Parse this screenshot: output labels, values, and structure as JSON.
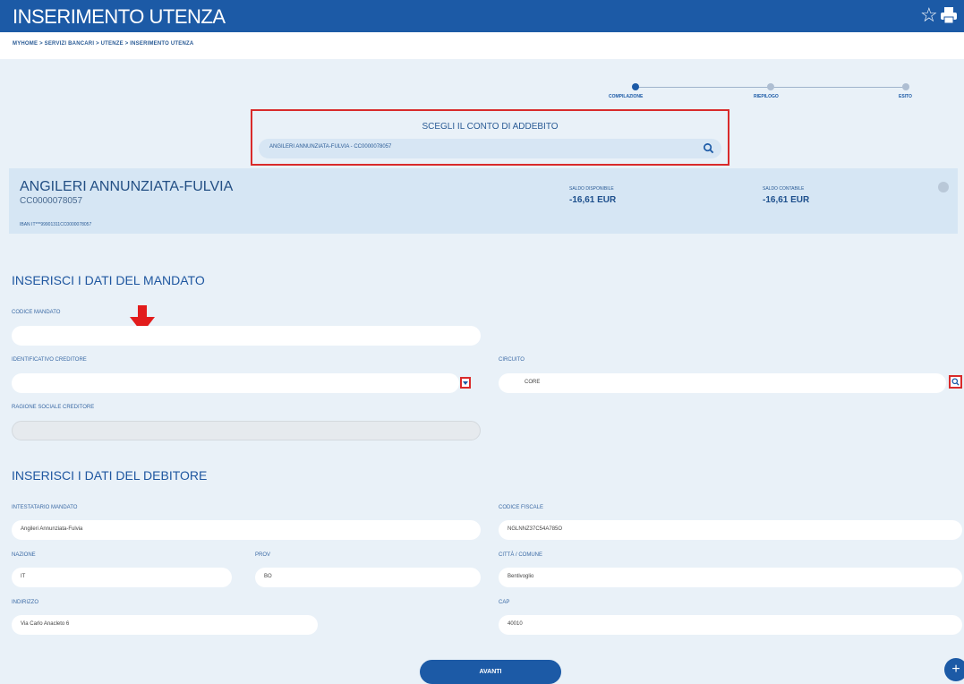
{
  "header": {
    "title": "INSERIMENTO UTENZA",
    "star_icon": "star-icon",
    "print_icon": "printer-icon",
    "breadcrumb": "MYHOME > SERVIZI BANCARI > UTENZE > INSERIMENTO UTENZA"
  },
  "stepper": {
    "steps": [
      {
        "label": "COMPILAZIONE",
        "active": true
      },
      {
        "label": "RIEPILOGO",
        "active": false
      },
      {
        "label": "ESITO",
        "active": false
      }
    ]
  },
  "conto": {
    "heading": "SCEGLI IL CONTO DI ADDEBITO",
    "selected": "ANGILERI ANNUNZIATA-FULVIA - CC0000078057"
  },
  "account": {
    "name": "ANGILERI ANNUNZIATA-FULVIA",
    "code": "CC0000078057",
    "iban": "IBAN IT***99901311CC0000078057",
    "saldo_disponibile_label": "SALDO DISPONIBILE",
    "saldo_disponibile": "-16,61 EUR",
    "saldo_contabile_label": "SALDO CONTABILE",
    "saldo_contabile": "-16,61 EUR"
  },
  "mandato": {
    "title": "INSERISCI I DATI DEL MANDATO",
    "codice_label": "CODICE MANDATO",
    "codice_value": "",
    "creditore_label": "IDENTIFICATIVO CREDITORE",
    "creditore_value": "",
    "circuito_label": "CIRCUITO",
    "circuito_value": "CORE",
    "ragione_label": "RAGIONE SOCIALE CREDITORE",
    "ragione_value": ""
  },
  "debitore": {
    "title": "INSERISCI I DATI DEL DEBITORE",
    "intestatario_label": "INTESTATARIO MANDATO",
    "intestatario_value": "Angileri Annunziata-Fulvia",
    "codice_fiscale_label": "CODICE FISCALE",
    "codice_fiscale_value": "NGLNNZ37C54A785O",
    "nazione_label": "NAZIONE",
    "nazione_value": "IT",
    "prov_label": "PROV",
    "prov_value": "BO",
    "citta_label": "CITTÀ / COMUNE",
    "citta_value": "Bentivoglio",
    "indirizzo_label": "INDIRIZZO",
    "indirizzo_value": "Via Carlo Anacleto 6",
    "cap_label": "CAP",
    "cap_value": "40010"
  },
  "actions": {
    "avanti": "AVANTI",
    "fab": "+"
  },
  "colors": {
    "brand": "#1c5aa6",
    "highlight": "#d92b2b",
    "background": "#e9f1f8"
  }
}
